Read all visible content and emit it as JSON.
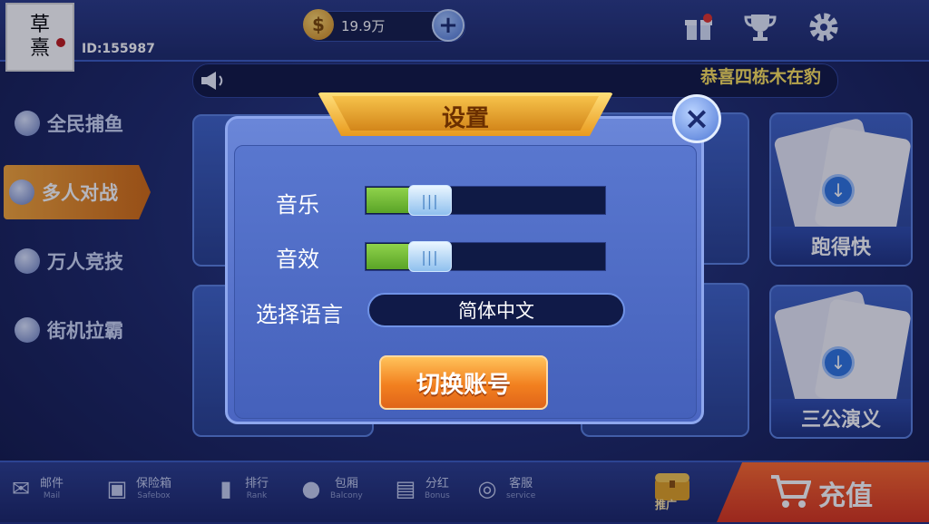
{
  "user": {
    "avatar_text_1": "草",
    "avatar_text_2": "熹",
    "id_label": "ID:155987"
  },
  "wallet": {
    "coins": "19.9万"
  },
  "marquee": {
    "text": "恭喜四栋木在豹"
  },
  "left_menu": [
    {
      "label": "全民捕鱼",
      "active": false
    },
    {
      "label": "多人对战",
      "active": true
    },
    {
      "label": "万人竞技",
      "active": false
    },
    {
      "label": "街机拉霸",
      "active": false
    }
  ],
  "cards": {
    "pdk": "跑得快",
    "sangong": "三公演义"
  },
  "dialog": {
    "title": "设置",
    "music_label": "音乐",
    "music_level": 0.34,
    "sfx_label": "音效",
    "sfx_level": 0.34,
    "language_label": "选择语言",
    "language_value": "简体中文",
    "switch_account_label": "切换账号"
  },
  "bottom_bar": [
    {
      "cn": "邮件",
      "en": "Mail",
      "icon": "mail-icon"
    },
    {
      "cn": "保险箱",
      "en": "Safebox",
      "icon": "safebox-icon"
    },
    {
      "cn": "排行",
      "en": "Rank",
      "icon": "rank-icon"
    },
    {
      "cn": "包厢",
      "en": "Balcony",
      "icon": "balcony-icon"
    },
    {
      "cn": "分红",
      "en": "Bonus",
      "icon": "bonus-icon"
    },
    {
      "cn": "客服",
      "en": "service",
      "icon": "service-icon"
    }
  ],
  "promo_label": "推广",
  "recharge_label": "充值",
  "colors": {
    "accent_orange": "#f2801f",
    "slider_green": "#8fd24b",
    "bg_blue": "#1c2766"
  }
}
